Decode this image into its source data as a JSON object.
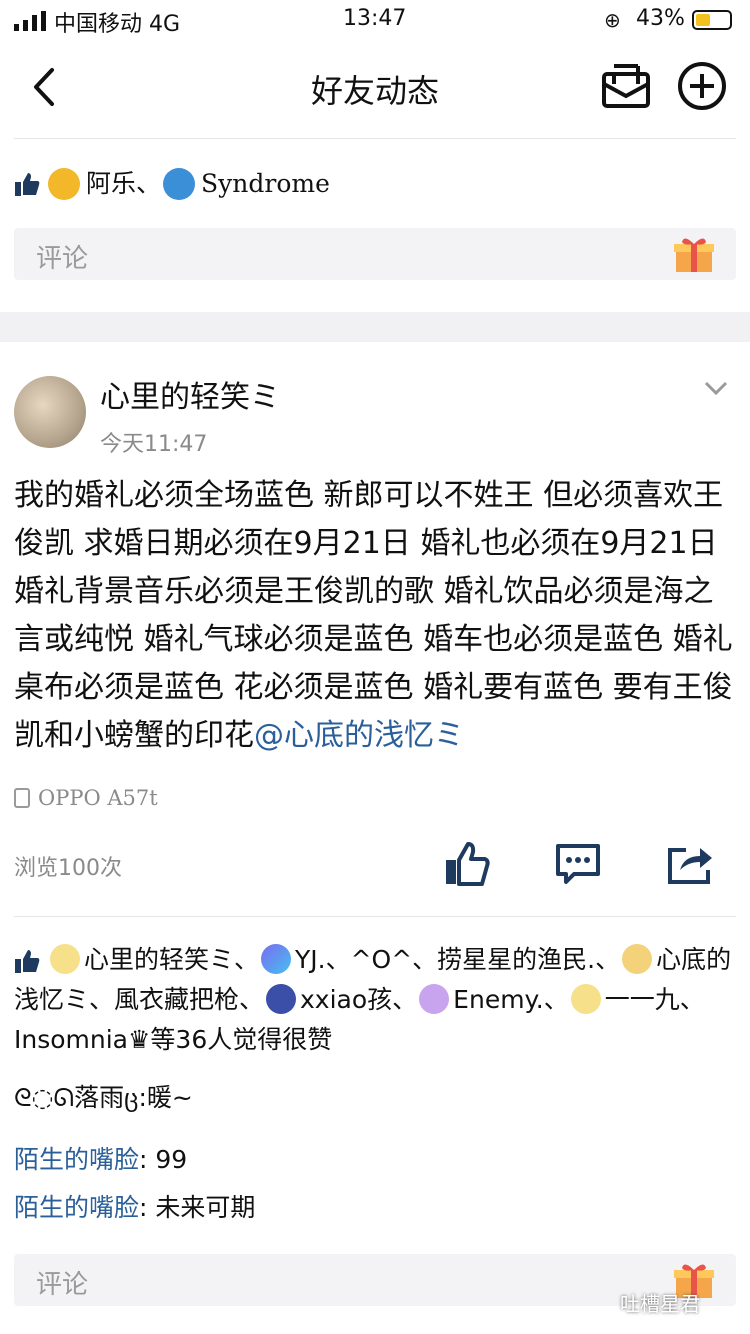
{
  "status_bar": {
    "carrier": "中国移动 4G",
    "time": "13:47",
    "battery": "43%"
  },
  "nav": {
    "title": "好友动态"
  },
  "previous_post": {
    "likes_users": [
      "阿乐、",
      "Syndrome"
    ],
    "comment_placeholder": "评论"
  },
  "post": {
    "author": "心里的轻笑ミ",
    "time": "今天11:47",
    "text": "我的婚礼必须全场蓝色 新郎可以不姓王 但必须喜欢王俊凯 求婚日期必须在9月21日 婚礼也必须在9月21日 婚礼背景音乐必须是王俊凯的歌 婚礼饮品必须是海之言或纯悦 婚礼气球必须是蓝色 婚车也必须是蓝色  婚礼桌布必须是蓝色  花必须是蓝色  婚礼要有蓝色 要有王俊凯和小螃蟹的印花",
    "mention": "@心底的浅忆ミ",
    "device": "OPPO A57t",
    "views": "浏览100次"
  },
  "likes": {
    "users": [
      "心里的轻笑ミ、",
      "YJ.、^O^、捞星星的渔民.、",
      "心底的浅忆ミ、風衣藏把枪、",
      "xxiao孩、",
      "Enemy.、",
      "一一九、Insomnia♛等36人觉得很赞"
    ]
  },
  "comments": [
    {
      "name": "",
      "text": "ᘓ◌ᘏ落雨ც:暖~"
    },
    {
      "name": "陌生的嘴脸",
      "text": ": 99"
    },
    {
      "name": "陌生的嘴脸",
      "text": ": 未来可期"
    }
  ],
  "comment_placeholder": "评论",
  "watermark": "吐槽星君",
  "colors": {
    "link": "#2a5f99",
    "gray_text": "#8a8a8a",
    "thumb_blue": "#1e3a5f"
  }
}
